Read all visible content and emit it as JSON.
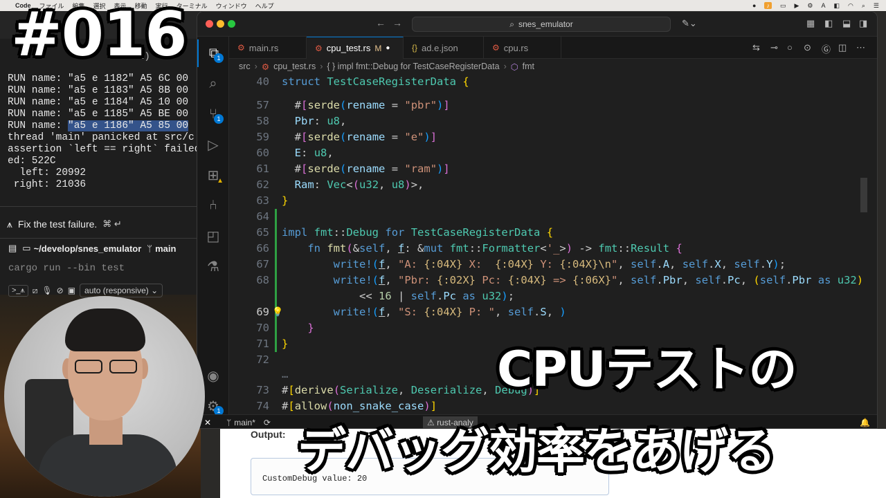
{
  "menubar": {
    "app": "Code",
    "items": [
      "ファイル",
      "編集",
      "選択",
      "表示",
      "移動",
      "実行",
      "ターミナル",
      "ウィンドウ",
      "ヘルプ"
    ]
  },
  "terminal": {
    "hidden_text": "n)",
    "lines": [
      {
        "pre": "RUN name: \"a5 e 1182\" A5 6C 00",
        "sel": ""
      },
      {
        "pre": "RUN name: \"a5 e 1183\" A5 8B 00",
        "sel": ""
      },
      {
        "pre": "RUN name: \"a5 e 1184\" A5 10 00",
        "sel": ""
      },
      {
        "pre": "RUN name: \"a5 e 1185\" A5 BE 00",
        "sel": ""
      },
      {
        "pre": "RUN name: ",
        "sel": "\"a5 e 1186\" A5 85 00"
      },
      {
        "pre": "thread 'main' panicked at src/c",
        "sel": ""
      },
      {
        "pre": "assertion `left == right` failed",
        "sel": ""
      },
      {
        "pre": "ed: 522C",
        "sel": ""
      },
      {
        "pre": "  left: 20992",
        "sel": ""
      },
      {
        "pre": " right: 21036",
        "sel": ""
      }
    ],
    "ai_prompt": "Fix the test failure.",
    "ai_shortcut": "⌘ ↵",
    "cwd": "~/develop/snes_emulator",
    "branch": "main",
    "command_placeholder": "cargo run --bin test",
    "model": "auto (responsive)"
  },
  "editor": {
    "search": "snes_emulator",
    "tabs": [
      {
        "label": "main.rs",
        "kind": "rs",
        "modified": ""
      },
      {
        "label": "cpu_test.rs",
        "kind": "rs",
        "modified": "M"
      },
      {
        "label": "ad.e.json",
        "kind": "json",
        "modified": ""
      },
      {
        "label": "cpu.rs",
        "kind": "rs",
        "modified": ""
      }
    ],
    "breadcrumb": [
      "src",
      "cpu_test.rs",
      "{ } impl fmt::Debug for TestCaseRegisterData",
      "fmt"
    ],
    "line_numbers": [
      "40",
      "57",
      "58",
      "59",
      "60",
      "61",
      "62",
      "63",
      "64",
      "65",
      "66",
      "67",
      "68",
      "",
      "69",
      "70",
      "71",
      "72",
      "",
      "73",
      "74"
    ],
    "status": {
      "branch": "main*",
      "rust": "rust-analy"
    }
  },
  "captions": {
    "episode": "#016",
    "line1": "CPUテストの",
    "line2": "デバッグ効率をあげる"
  },
  "browser": {
    "output_label": "Output:",
    "output_value": "CustomDebug value: 20"
  }
}
